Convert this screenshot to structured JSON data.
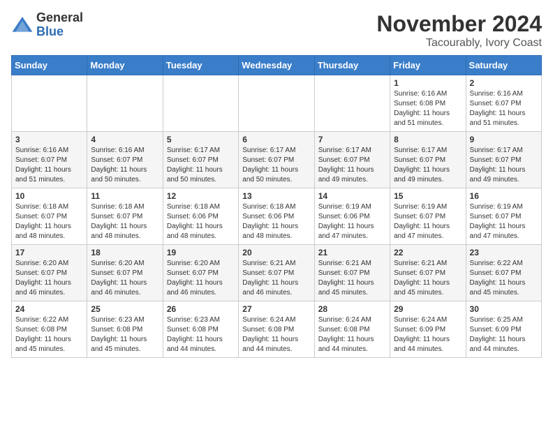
{
  "header": {
    "logo_line1": "General",
    "logo_line2": "Blue",
    "title": "November 2024",
    "subtitle": "Tacourably, Ivory Coast"
  },
  "weekdays": [
    "Sunday",
    "Monday",
    "Tuesday",
    "Wednesday",
    "Thursday",
    "Friday",
    "Saturday"
  ],
  "weeks": [
    [
      {
        "day": "",
        "info": ""
      },
      {
        "day": "",
        "info": ""
      },
      {
        "day": "",
        "info": ""
      },
      {
        "day": "",
        "info": ""
      },
      {
        "day": "",
        "info": ""
      },
      {
        "day": "1",
        "info": "Sunrise: 6:16 AM\nSunset: 6:08 PM\nDaylight: 11 hours and 51 minutes."
      },
      {
        "day": "2",
        "info": "Sunrise: 6:16 AM\nSunset: 6:07 PM\nDaylight: 11 hours and 51 minutes."
      }
    ],
    [
      {
        "day": "3",
        "info": "Sunrise: 6:16 AM\nSunset: 6:07 PM\nDaylight: 11 hours and 51 minutes."
      },
      {
        "day": "4",
        "info": "Sunrise: 6:16 AM\nSunset: 6:07 PM\nDaylight: 11 hours and 50 minutes."
      },
      {
        "day": "5",
        "info": "Sunrise: 6:17 AM\nSunset: 6:07 PM\nDaylight: 11 hours and 50 minutes."
      },
      {
        "day": "6",
        "info": "Sunrise: 6:17 AM\nSunset: 6:07 PM\nDaylight: 11 hours and 50 minutes."
      },
      {
        "day": "7",
        "info": "Sunrise: 6:17 AM\nSunset: 6:07 PM\nDaylight: 11 hours and 49 minutes."
      },
      {
        "day": "8",
        "info": "Sunrise: 6:17 AM\nSunset: 6:07 PM\nDaylight: 11 hours and 49 minutes."
      },
      {
        "day": "9",
        "info": "Sunrise: 6:17 AM\nSunset: 6:07 PM\nDaylight: 11 hours and 49 minutes."
      }
    ],
    [
      {
        "day": "10",
        "info": "Sunrise: 6:18 AM\nSunset: 6:07 PM\nDaylight: 11 hours and 48 minutes."
      },
      {
        "day": "11",
        "info": "Sunrise: 6:18 AM\nSunset: 6:07 PM\nDaylight: 11 hours and 48 minutes."
      },
      {
        "day": "12",
        "info": "Sunrise: 6:18 AM\nSunset: 6:06 PM\nDaylight: 11 hours and 48 minutes."
      },
      {
        "day": "13",
        "info": "Sunrise: 6:18 AM\nSunset: 6:06 PM\nDaylight: 11 hours and 48 minutes."
      },
      {
        "day": "14",
        "info": "Sunrise: 6:19 AM\nSunset: 6:06 PM\nDaylight: 11 hours and 47 minutes."
      },
      {
        "day": "15",
        "info": "Sunrise: 6:19 AM\nSunset: 6:07 PM\nDaylight: 11 hours and 47 minutes."
      },
      {
        "day": "16",
        "info": "Sunrise: 6:19 AM\nSunset: 6:07 PM\nDaylight: 11 hours and 47 minutes."
      }
    ],
    [
      {
        "day": "17",
        "info": "Sunrise: 6:20 AM\nSunset: 6:07 PM\nDaylight: 11 hours and 46 minutes."
      },
      {
        "day": "18",
        "info": "Sunrise: 6:20 AM\nSunset: 6:07 PM\nDaylight: 11 hours and 46 minutes."
      },
      {
        "day": "19",
        "info": "Sunrise: 6:20 AM\nSunset: 6:07 PM\nDaylight: 11 hours and 46 minutes."
      },
      {
        "day": "20",
        "info": "Sunrise: 6:21 AM\nSunset: 6:07 PM\nDaylight: 11 hours and 46 minutes."
      },
      {
        "day": "21",
        "info": "Sunrise: 6:21 AM\nSunset: 6:07 PM\nDaylight: 11 hours and 45 minutes."
      },
      {
        "day": "22",
        "info": "Sunrise: 6:21 AM\nSunset: 6:07 PM\nDaylight: 11 hours and 45 minutes."
      },
      {
        "day": "23",
        "info": "Sunrise: 6:22 AM\nSunset: 6:07 PM\nDaylight: 11 hours and 45 minutes."
      }
    ],
    [
      {
        "day": "24",
        "info": "Sunrise: 6:22 AM\nSunset: 6:08 PM\nDaylight: 11 hours and 45 minutes."
      },
      {
        "day": "25",
        "info": "Sunrise: 6:23 AM\nSunset: 6:08 PM\nDaylight: 11 hours and 45 minutes."
      },
      {
        "day": "26",
        "info": "Sunrise: 6:23 AM\nSunset: 6:08 PM\nDaylight: 11 hours and 44 minutes."
      },
      {
        "day": "27",
        "info": "Sunrise: 6:24 AM\nSunset: 6:08 PM\nDaylight: 11 hours and 44 minutes."
      },
      {
        "day": "28",
        "info": "Sunrise: 6:24 AM\nSunset: 6:08 PM\nDaylight: 11 hours and 44 minutes."
      },
      {
        "day": "29",
        "info": "Sunrise: 6:24 AM\nSunset: 6:09 PM\nDaylight: 11 hours and 44 minutes."
      },
      {
        "day": "30",
        "info": "Sunrise: 6:25 AM\nSunset: 6:09 PM\nDaylight: 11 hours and 44 minutes."
      }
    ]
  ]
}
